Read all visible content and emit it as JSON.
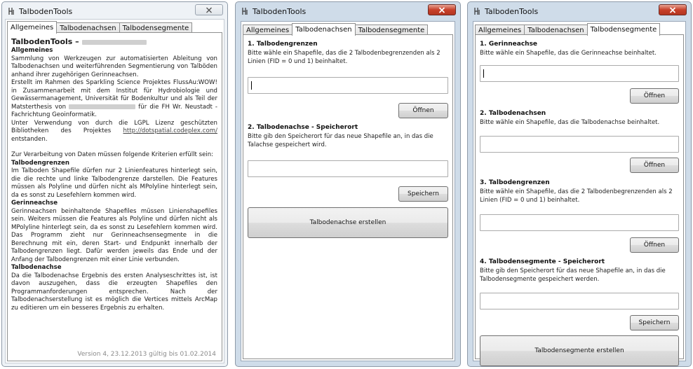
{
  "app": {
    "title": "TalbodenTools"
  },
  "tabs": [
    "Allgemeines",
    "Talbodenachsen",
    "Talbodensegmente"
  ],
  "colors": {
    "close_red": "#c8412a",
    "window_frame": "#cfdce9"
  },
  "icons": {
    "app": "app-icon",
    "close": "close-icon"
  },
  "allgemeines": {
    "heading": "TalbodenTools –",
    "p1_title": "Allgemeines",
    "p1": "Sammlung von Werkzeugen zur automatisierten Ableitung von Talbodenachsen und weiterführenden Segmentierung von Talböden anhand ihrer zugehörigen Gerinneachsen.",
    "p2": "Erstellt im Rahmen des Sparkling Science Projektes FlussAu:WOW! in Zusammenarbeit mit dem Institut für Hydrobiologie und Gewässermanagement, Universität für Bodenkultur und als Teil der Matsterthesis von",
    "p2_after": "für die FH Wr. Neustadt - Fachrichtung Geoinformatik.",
    "p3": "Unter Verwendung von durch die LGPL Lizenz geschützten Bibliotheken des Projektes",
    "p3_link": "http://dotspatial.codeplex.com/",
    "p3_end": "entstanden.",
    "p4": "Zur Verarbeitung von Daten müssen folgende Kriterien erfüllt sein:",
    "s1_title": "Talbodengrenzen",
    "s1": "Im Talboden Shapefile dürfen nur 2 Linienfeatures hinterlegt sein, die die rechte und linke Talbodengrenze darstellen. Die Features müssen als Polyline und dürfen nicht als MPolyline hinterlegt sein, da es sonst zu Lesefehlern kommen wird.",
    "s2_title": "Gerinneachse",
    "s2": "Gerinneachsen beinhaltende Shapefiles müssen Linienshapefiles sein. Weiters müssen die Features als Polyline und dürfen nicht als MPolyline hinterlegt sein, da es sonst zu Lesefehlern kommen wird. Das Programm zieht nur Gerinneachsensegmente in die Berechnung mit ein, deren Start- und Endpunkt innerhalb der Talbodengrenzen liegt. Dafür werden jeweils das Ende und der Anfang der Talbodengrenzen mit einer Linie verbunden.",
    "s3_title": "Talbodenachse",
    "s3": "Da die Talbodenachse Ergebnis des ersten Analyseschrittes ist, ist davon auszugehen, dass die erzeugten Shapefiles den Programmanforderungen entsprechen. Nach der Talbodenachserstellung ist es möglich die Vertices mittels ArcMap zu editieren um ein besseres Ergebnis zu erhalten.",
    "footer": "Version 4, 23.12.2013 gültig bis 01.02.2014"
  },
  "achsen": {
    "s1_title": "1. Talbodengrenzen",
    "s1_desc": "Bitte wähle ein Shapefile, das die 2 Talbodenbegrenzenden als 2 Linien (FID = 0 und 1) beinhaltet.",
    "open_label": "Öffnen",
    "s2_title": "2. Talbodenachse - Speicherort",
    "s2_desc": "Bitte gib den Speicherort für das neue Shapefile an, in das die Talachse gespeichert wird.",
    "save_label": "Speichern",
    "create_label": "Talbodenachse erstellen"
  },
  "segmente": {
    "s1_title": "1. Gerinneachse",
    "s1_desc": "Bitte wähle ein Shapefile, das die Gerinneachse beinhaltet.",
    "s2_title": "2. Talbodenachsen",
    "s2_desc": "Bitte wähle ein Shapefile, das die Talbodenachse beinhaltet.",
    "s3_title": "3. Talbodengrenzen",
    "s3_desc": "Bitte wähle ein Shapefile, das die 2 Talbodenbegrenzenden als 2 Linien (FID = 0 und 1) beinhaltet.",
    "s4_title": "4. Talbodensegmente - Speicherort",
    "s4_desc": "Bitte gib den Speicherort für das neue Shapefile an, in das die Talbodensegmente gespeichert werden.",
    "open_label": "Öffnen",
    "save_label": "Speichern",
    "create_label": "Talbodensegmente erstellen"
  }
}
